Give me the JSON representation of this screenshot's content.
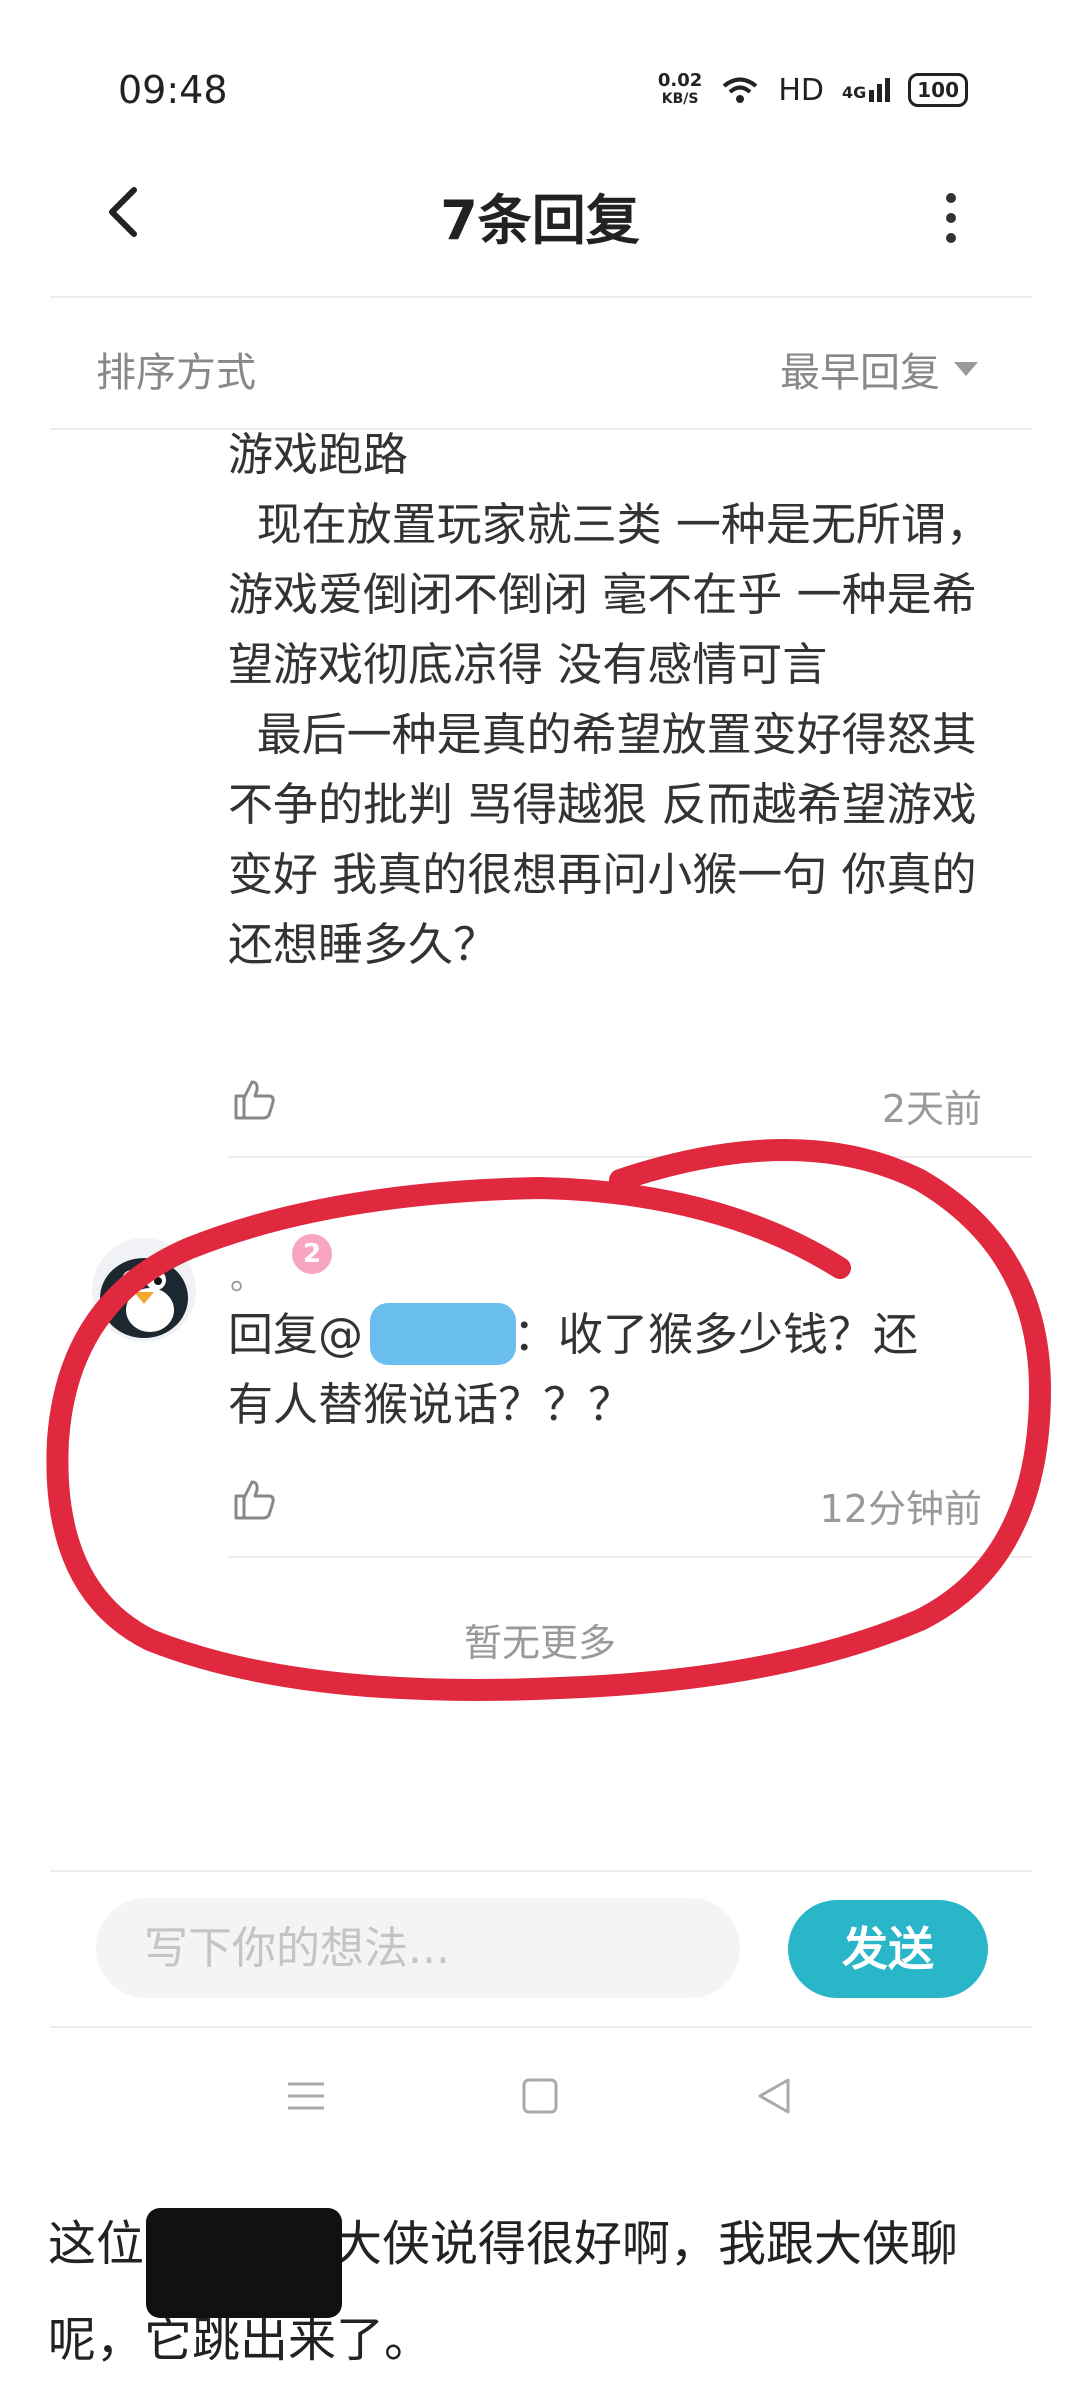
{
  "status_bar": {
    "time": "09:48",
    "speed_value": "0.02",
    "speed_unit": "KB/S",
    "network": "HD",
    "signal_label": "4G",
    "battery": "100"
  },
  "header": {
    "title": "7条回复",
    "back_icon": "chevron-left-icon",
    "more_icon": "more-vertical-icon"
  },
  "sort": {
    "label": "排序方式",
    "value": "最早回复"
  },
  "comments": [
    {
      "text": "游戏跑路\n  现在放置玩家就三类 一种是无所谓，游戏爱倒闭不倒闭 毫不在乎 一种是希望游戏彻底凉得 没有感情可言\n  最后一种是真的希望放置变好得怒其不争的批判 骂得越狠 反而越希望游戏变好 我真的很想再问小猴一句 你真的还想睡多久？",
      "time": "2天前"
    },
    {
      "user_dot": "。",
      "badge": "2",
      "reply_prefix": "回复@",
      "reply_rest": "：收了猴多少钱？还",
      "reply_line2": "有人替猴说话？？？",
      "time": "12分钟前"
    }
  ],
  "no_more": "暂无更多",
  "input": {
    "placeholder": "写下你的想法..."
  },
  "send_label": "发送",
  "caption": {
    "prefix": "这位",
    "rest": "大侠说得很好啊，我跟大侠聊",
    "line2": "呢，它跳出来了。"
  },
  "colors": {
    "accent": "#2ab6c9",
    "annotation": "#e0283e",
    "badge": "#f8a5c2",
    "redaction_blue": "#4fb3ea"
  }
}
